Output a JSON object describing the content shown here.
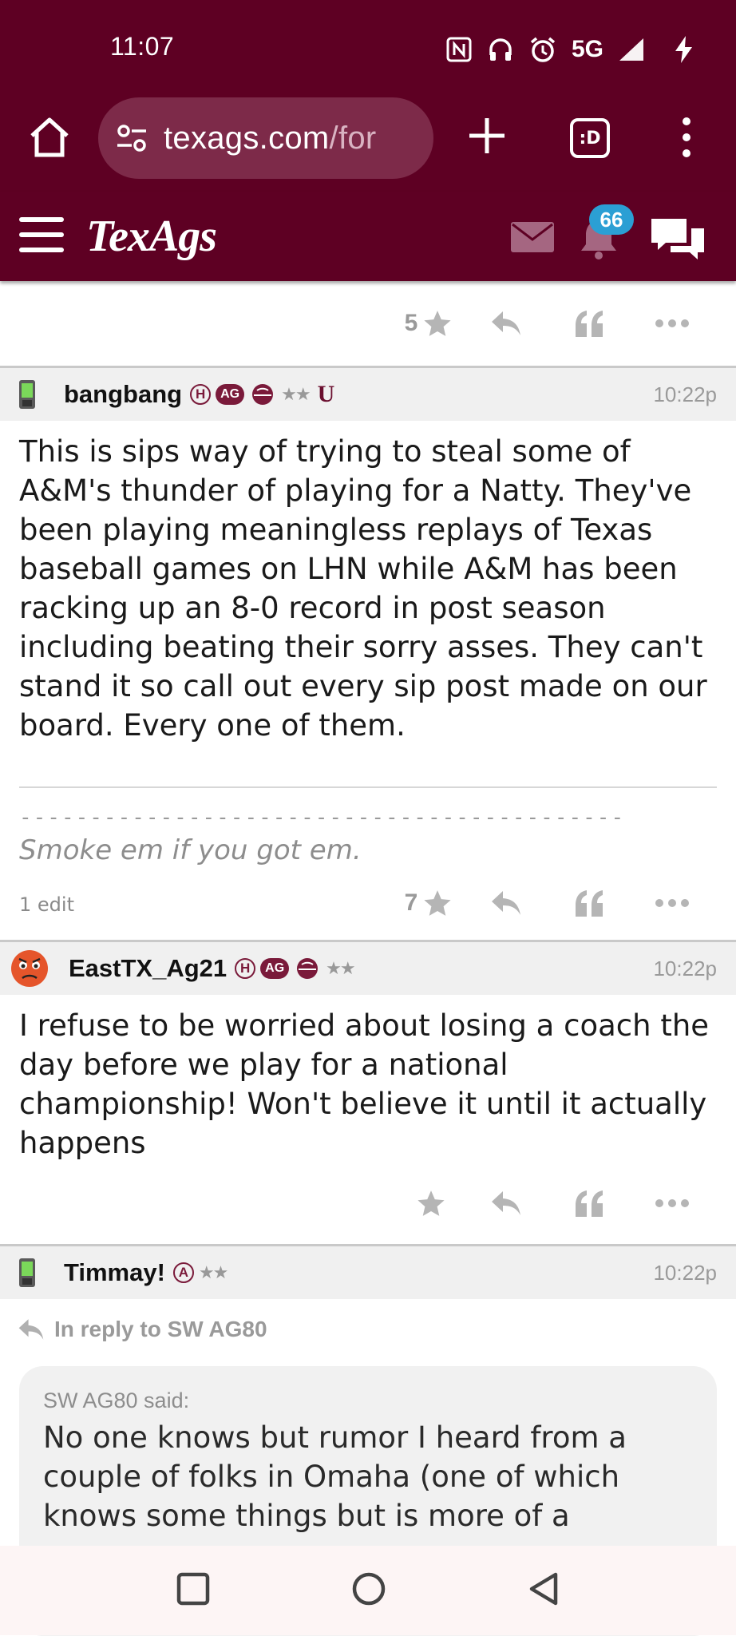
{
  "status_bar": {
    "time": "11:07",
    "network": "5G",
    "icons": [
      "nfc-icon",
      "headphones-icon",
      "alarm-icon",
      "signal-icon",
      "charging-icon"
    ]
  },
  "browser": {
    "url_host": "texags.com",
    "url_path": "/for",
    "tabs_label": ":D",
    "icons": [
      "home-icon",
      "site-settings-icon",
      "new-tab-icon",
      "tabs-icon",
      "overflow-menu-icon"
    ]
  },
  "site_header": {
    "logo": "TexAgs",
    "notifications_count": "66",
    "icons": [
      "hamburger-icon",
      "mail-icon",
      "bell-icon",
      "chat-icon"
    ]
  },
  "posts": [
    {
      "actions": {
        "stars": "5"
      }
    },
    {
      "username": "bangbang",
      "user_badges": {
        "h": "H",
        "ag": "AG",
        "stars": "★★",
        "u": "U"
      },
      "time": "10:22p",
      "body": "This is sips way of trying to steal some of A&M's thunder of playing for a Natty. They've been playing meaningless replays of Texas baseball games on LHN while A&M has been racking up an 8-0 record in post season including beating their sorry asses. They can't stand it so call out every sip post made on our board. Every one of them.",
      "signature_dashes": "-----------------------------------------------------------------",
      "signature": "Smoke em if you got em.",
      "edit_note": "1 edit",
      "actions": {
        "stars": "7"
      }
    },
    {
      "username": "EastTX_Ag21",
      "user_badges": {
        "h": "H",
        "ag": "AG",
        "stars": "★★"
      },
      "time": "10:22p",
      "body": "I refuse to be worried about losing a coach the day before we play for a national championship! Won't believe it until it actually happens",
      "actions": {
        "stars": ""
      }
    },
    {
      "username": "Timmay!",
      "user_badges": {
        "a": "A",
        "stars": "★★"
      },
      "time": "10:22p",
      "reply_to": "In reply to SW AG80",
      "quote_author": "SW AG80 said:",
      "quote_text": "No one knows but rumor I heard from a couple of folks in Omaha (one of which knows some things but is more of a"
    }
  ],
  "nav_bar": {
    "icons": [
      "recents-icon",
      "home-circle-icon",
      "back-icon"
    ]
  }
}
